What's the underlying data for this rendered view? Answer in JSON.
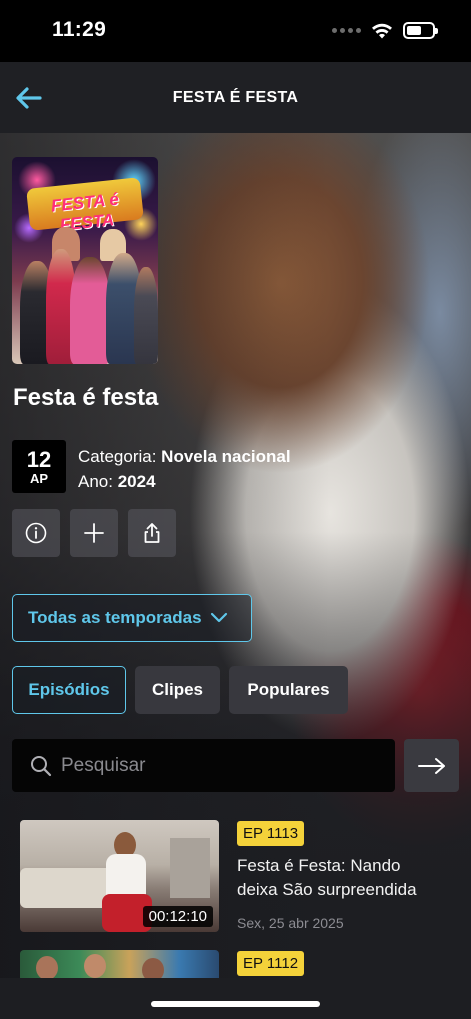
{
  "status_bar": {
    "time": "11:29"
  },
  "nav": {
    "title": "FESTA É FESTA"
  },
  "show": {
    "poster_logo_text": "FESTA é FESTA",
    "title": "Festa é festa",
    "rating_number": "12",
    "rating_label": "AP",
    "category_label": "Categoria: ",
    "category_value": "Novela nacional",
    "year_label": "Ano: ",
    "year_value": "2024"
  },
  "season_selector": {
    "label": "Todas as temporadas"
  },
  "tabs": [
    {
      "label": "Episódios",
      "active": true
    },
    {
      "label": "Clipes",
      "active": false
    },
    {
      "label": "Populares",
      "active": false
    }
  ],
  "search": {
    "placeholder": "Pesquisar"
  },
  "episodes": [
    {
      "badge": "EP 1113",
      "title": "Festa é Festa: Nando deixa São surpreendida",
      "date": "Sex, 25 abr 2025",
      "duration": "00:12:10"
    },
    {
      "badge": "EP 1112"
    }
  ],
  "colors": {
    "accent": "#5fc7ea",
    "badge": "#f4d23a",
    "background": "#1d1e22"
  }
}
